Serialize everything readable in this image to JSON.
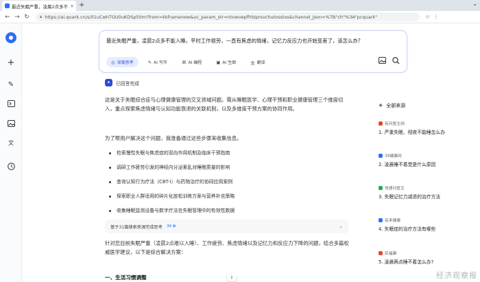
{
  "browser": {
    "tab_title": "最近失眠严重，凌晨2点多不能",
    "tab_close": "×",
    "new_tab": "+",
    "window_controls": "⌄",
    "url": "https://ai.quark.cn/s/01uCwhTGU0uKDSp50m?from=kkframenew&uc_param_str=ntnwvepffrbiprsvchutosstxs&channel_json=%7B\"ch\"%3A\"pcquark\""
  },
  "rail": {
    "items": [
      "quark-logo",
      "plus",
      "edit",
      "terminal",
      "image",
      "translate",
      "history"
    ]
  },
  "query": {
    "text": "最近失眠严重，凌晨2点多不能入睡。平时工作很劳，一直有焦虑的情绪，记忆力反应力也开始变差了，该怎么办？",
    "chips": [
      {
        "label": "深度思考",
        "icon": "◎",
        "active": true
      },
      {
        "label": "AI 写作",
        "icon": "✎",
        "active": false
      },
      {
        "label": "AI 编程",
        "icon": "⌘",
        "active": false
      },
      {
        "label": "AI 生图",
        "icon": "▣",
        "active": false
      },
      {
        "label": "翻译",
        "icon": "文",
        "active": false
      }
    ]
  },
  "answer": {
    "status": "已回答完成",
    "status_icon": "✦",
    "intro": "这是关于失眠综合症与心理健康管理的交叉领域问题。需从睡眠医学、心理干预和职业健康管理三个维度切入，重点探索焦虑情绪与认知功能衰退的关联机制，以及多维度干预方案的协同作用。",
    "plan_intro": "为了帮用户解决这个问题，我准备通过这些步骤来收集信息。",
    "steps": [
      "检索慢性失眠与焦虑症的双向作用机制及临床干预指南",
      "调研工作疲劳引发的神经内分泌紊乱对睡眠质量的影响",
      "查询认知行为疗法（CBT-I）与药物治疗的协同应用案例",
      "探索职业人群适用的碎片化放松训练方案与营养补充策略",
      "收集睡眠监测设备与数字疗法在失眠管理中的有效性数据"
    ],
    "ref_summary": "基于31篇搜索来源完成思考",
    "ref_mini": "39 ✿",
    "ref_chevron": "⌄",
    "conclusion": "针对您目前失眠严重（凌晨2点难以入睡）、工作疲劳、焦虑情绪以及记忆力和反应力下降的问题，结合多篇权威医学建议，以下是综合解决方案：",
    "section_heading": "一、生活习惯调整"
  },
  "sources": {
    "header": "全部来源",
    "header_icon": "❖",
    "items": [
      {
        "site": "有问医生网",
        "title": "1. 严重失眠、彻夜不能睡怎么办",
        "color": "#e8452c"
      },
      {
        "site": "39健康网",
        "title": "2. 凌晨睡不着觉是什么原因",
        "color": "#2f6cf6"
      },
      {
        "site": "快速问医生",
        "title": "3. 失眠记忆力减退的治疗方法",
        "color": "#27a85a"
      },
      {
        "site": "有来健康",
        "title": "4. 失眠症的治疗方法有哪些",
        "color": "#2f6cf6"
      },
      {
        "site": "民福康",
        "title": "5. 凌晨两点睡不着怎么办?",
        "color": "#e8452c"
      }
    ]
  },
  "watermark": "经济观察报"
}
